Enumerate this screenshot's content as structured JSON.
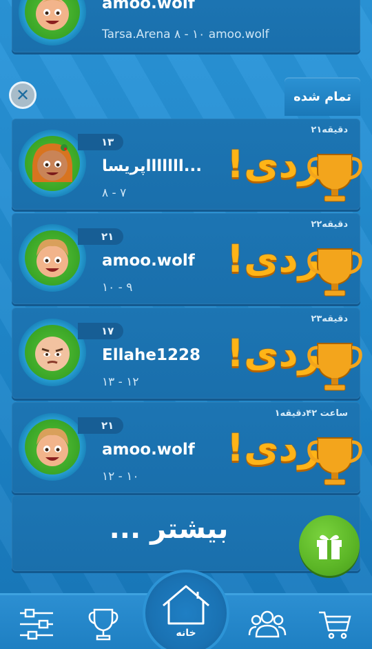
{
  "top_match": {
    "player": "amoo.wolf",
    "score_line": "Tarsa.Arena ۸ - ۱۰ amoo.wolf"
  },
  "tab": {
    "label": "تمام شده"
  },
  "matches": [
    {
      "time": "۲۱دقیقه",
      "level": "۱۳",
      "player": "پریساlllllll...",
      "score": "۸ - ۷",
      "result": "بردی!",
      "avatar": "girl-avatar-icon"
    },
    {
      "time": "۲۲دقیقه",
      "level": "۲۱",
      "player": "amoo.wolf",
      "score": "۱۰ - ۹",
      "result": "بردی!",
      "avatar": "boy-avatar-icon"
    },
    {
      "time": "۲۳دقیقه",
      "level": "۱۷",
      "player": "Ellahe1228",
      "score": "۱۳ - ۱۲",
      "result": "بردی!",
      "avatar": "bald-avatar-icon"
    },
    {
      "time": "۱ساعت ۴۲دقیقه",
      "level": "۲۱",
      "player": "amoo.wolf",
      "score": "۱۲ - ۱۰",
      "result": "بردی!",
      "avatar": "boy-avatar-icon"
    }
  ],
  "more": {
    "label": "بیشتر ..."
  },
  "nav": {
    "home_label": "خانه"
  },
  "colors": {
    "accent_gold": "#ffb417",
    "avatar_green": "#3aa526",
    "card_blue": "#1c75b3"
  }
}
